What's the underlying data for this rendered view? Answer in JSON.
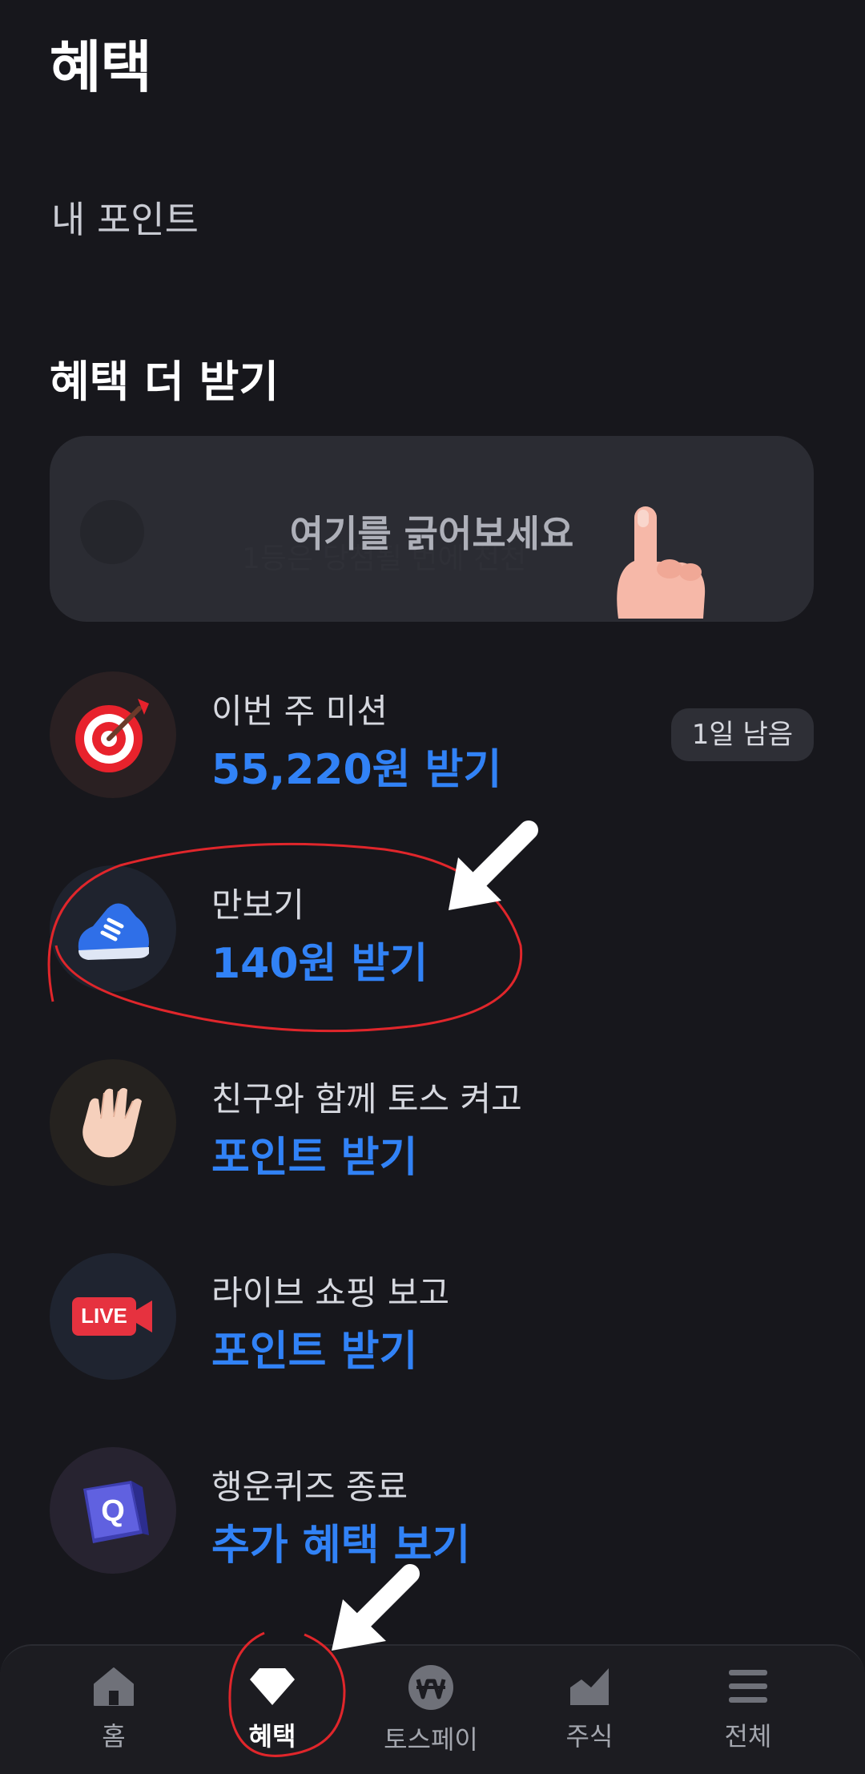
{
  "page": {
    "title": "혜택"
  },
  "points": {
    "label": "내 포인트"
  },
  "section": {
    "title": "혜택 더 받기"
  },
  "scratch": {
    "prompt": "여기를 긁어보세요",
    "hidden_text": "1등은 당첨될 번에 천천"
  },
  "items": [
    {
      "title": "이번 주 미션",
      "action": "55,220원 받기",
      "badge": "1일 남음",
      "icon": "target-icon"
    },
    {
      "title": "만보기",
      "action": "140원 받기",
      "icon": "sneaker-icon"
    },
    {
      "title": "친구와 함께 토스 켜고",
      "action": "포인트 받기",
      "icon": "waving-hand-icon"
    },
    {
      "title": "라이브 쇼핑 보고",
      "action": "포인트 받기",
      "icon": "live-camera-icon",
      "icon_text": "LIVE"
    },
    {
      "title": "행운퀴즈 종료",
      "action": "추가 혜택 보기",
      "icon": "quiz-cube-icon",
      "icon_text": "Q"
    }
  ],
  "tabs": [
    {
      "label": "홈",
      "icon": "home-icon"
    },
    {
      "label": "혜택",
      "icon": "diamond-icon",
      "active": true
    },
    {
      "label": "토스페이",
      "icon": "won-coin-icon"
    },
    {
      "label": "주식",
      "icon": "chart-icon"
    },
    {
      "label": "전체",
      "icon": "menu-icon"
    }
  ],
  "colors": {
    "background": "#17171c",
    "accent": "#3182f6",
    "annotation": "#e0262b"
  }
}
